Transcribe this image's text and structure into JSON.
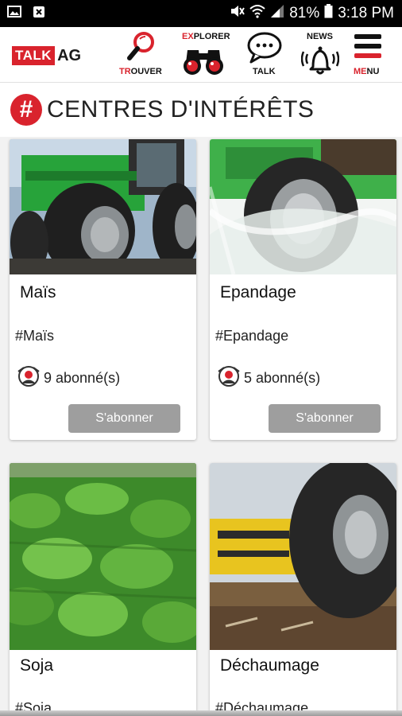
{
  "status_bar": {
    "battery": "81%",
    "time": "3:18 PM",
    "icons": [
      "gallery-icon",
      "app-notification-icon",
      "mute-icon",
      "wifi-icon",
      "signal-icon",
      "battery-icon"
    ]
  },
  "header": {
    "logo_talk": "TALK",
    "logo_ag": "AG",
    "nav": [
      {
        "label_red": "TR",
        "label_rest": "OUVER",
        "icon": "search-icon"
      },
      {
        "label_red": "EX",
        "label_rest": "PLORER",
        "icon": "binoculars-icon"
      },
      {
        "label": "TALK",
        "icon": "chat-bubble-icon"
      },
      {
        "label": "NEWS",
        "icon": "bell-icon"
      },
      {
        "label_red": "ME",
        "label_rest": "NU",
        "icon": "hamburger-menu-icon"
      }
    ]
  },
  "section": {
    "hash": "#",
    "title": "CENTRES D'INTÉRÊTS"
  },
  "cards": [
    {
      "title": "Maïs",
      "tag": "#Maïs",
      "subscribers": "9 abonné(s)",
      "button": "S'abonner",
      "image": "green tractor"
    },
    {
      "title": "Epandage",
      "tag": "#Epandage",
      "subscribers": "5 abonné(s)",
      "button": "S'abonner",
      "image": "green machine wheel with spray"
    },
    {
      "title": "Soja",
      "tag": "#Soja",
      "image": "soybean field"
    },
    {
      "title": "Déchaumage",
      "tag": "#Déchaumage",
      "image": "yellow stubble cultivator and tractor wheel"
    }
  ],
  "colors": {
    "brand_red": "#d9232d",
    "button_grey": "#9e9e9e"
  }
}
